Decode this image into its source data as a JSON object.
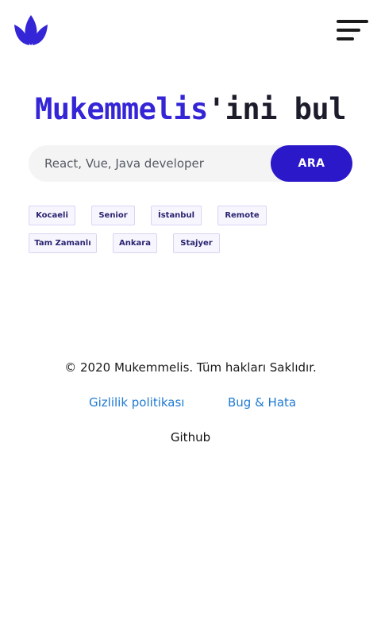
{
  "header": {
    "logo_icon": "lotus-leaf-logo-icon",
    "menu_icon": "hamburger-menu-icon"
  },
  "hero": {
    "brand": "Mukemmelis",
    "suffix": "'ini bul"
  },
  "search": {
    "placeholder": "React, Vue, Java developer",
    "value": "",
    "button_label": "ARA"
  },
  "tags": [
    "Kocaeli",
    "Senior",
    "İstanbul",
    "Remote",
    "Tam Zamanlı",
    "Ankara",
    "Stajyer"
  ],
  "footer": {
    "copyright": "© 2020 Mukemmelis. Tüm hakları Saklıdır.",
    "privacy_link": "Gizlilik politikası",
    "bug_link": "Bug & Hata",
    "github_link": "Github"
  },
  "colors": {
    "brand": "#3425d6",
    "button": "#2b18c9",
    "link": "#1f7ad1",
    "tag_bg": "#f7f6ff",
    "tag_border": "#d8d4f2"
  }
}
